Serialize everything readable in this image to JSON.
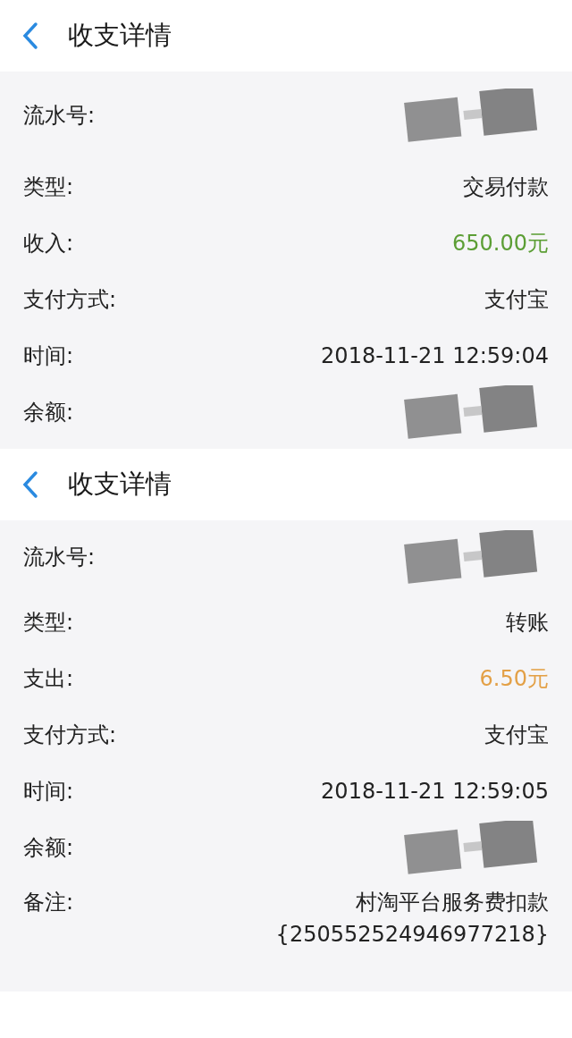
{
  "screens": [
    {
      "title": "收支详情",
      "rows": [
        {
          "label": "流水号:",
          "redacted": true
        },
        {
          "label": "类型:",
          "value": "交易付款"
        },
        {
          "label": "收入:",
          "value": "650.00元",
          "color": "#5c9e35"
        },
        {
          "label": "支付方式:",
          "value": "支付宝"
        },
        {
          "label": "时间:",
          "value": "2018-11-21 12:59:04"
        },
        {
          "label": "余额:",
          "redacted": true
        }
      ]
    },
    {
      "title": "收支详情",
      "rows": [
        {
          "label": "流水号:",
          "redacted": true
        },
        {
          "label": "类型:",
          "value": "转账"
        },
        {
          "label": "支出:",
          "value": "6.50元",
          "color": "#e3a046"
        },
        {
          "label": "支付方式:",
          "value": "支付宝"
        },
        {
          "label": "时间:",
          "value": "2018-11-21 12:59:05"
        },
        {
          "label": "余额:",
          "redacted": true
        },
        {
          "label": "备注:",
          "value": "村淘平台服务费扣款",
          "value_line_2": "{250552524946977218}"
        }
      ]
    }
  ]
}
